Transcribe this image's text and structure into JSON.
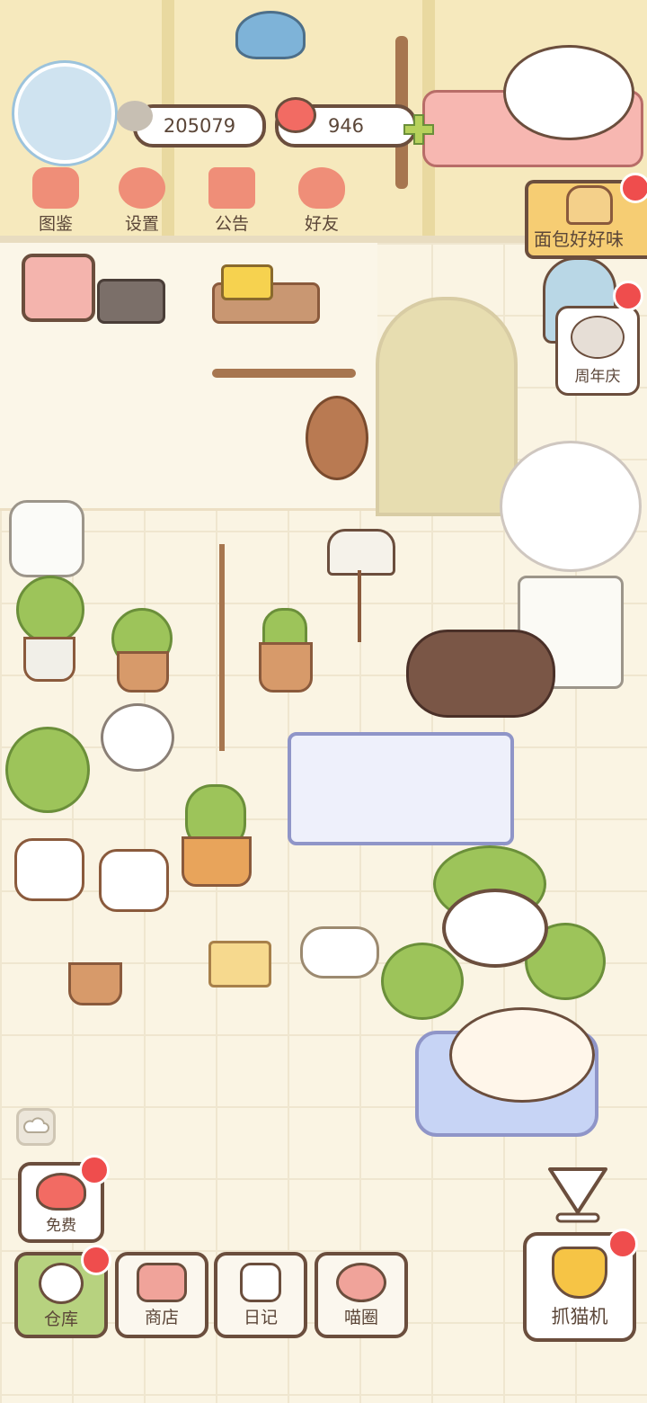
{
  "currency": {
    "fish": "205079",
    "hearts": "946"
  },
  "top_menu": [
    {
      "label": "图鉴",
      "icon": "cat-face-icon"
    },
    {
      "label": "设置",
      "icon": "gear-icon"
    },
    {
      "label": "公告",
      "icon": "gift-icon"
    },
    {
      "label": "好友",
      "icon": "friends-icon"
    }
  ],
  "event": {
    "label": "面包好好味",
    "icon": "bread-icon"
  },
  "anniversary": {
    "label": "周年庆",
    "icon": "cake-cat-icon"
  },
  "free": {
    "label": "免费",
    "icon": "heart-face-icon"
  },
  "bottom_nav": [
    {
      "label": "仓库",
      "icon": "storage-icon",
      "active": true
    },
    {
      "label": "商店",
      "icon": "shop-icon",
      "active": false
    },
    {
      "label": "日记",
      "icon": "diary-icon",
      "active": false
    },
    {
      "label": "喵圈",
      "icon": "planet-cat-icon",
      "active": false
    }
  ],
  "claw_machine": {
    "label": "抓猫机",
    "icon": "claw-icon"
  },
  "colors": {
    "outline": "#6b4e3d",
    "notify_dot": "#ef4d4d",
    "active_nav": "#b7d27f",
    "event_tag": "#f6cd73"
  }
}
